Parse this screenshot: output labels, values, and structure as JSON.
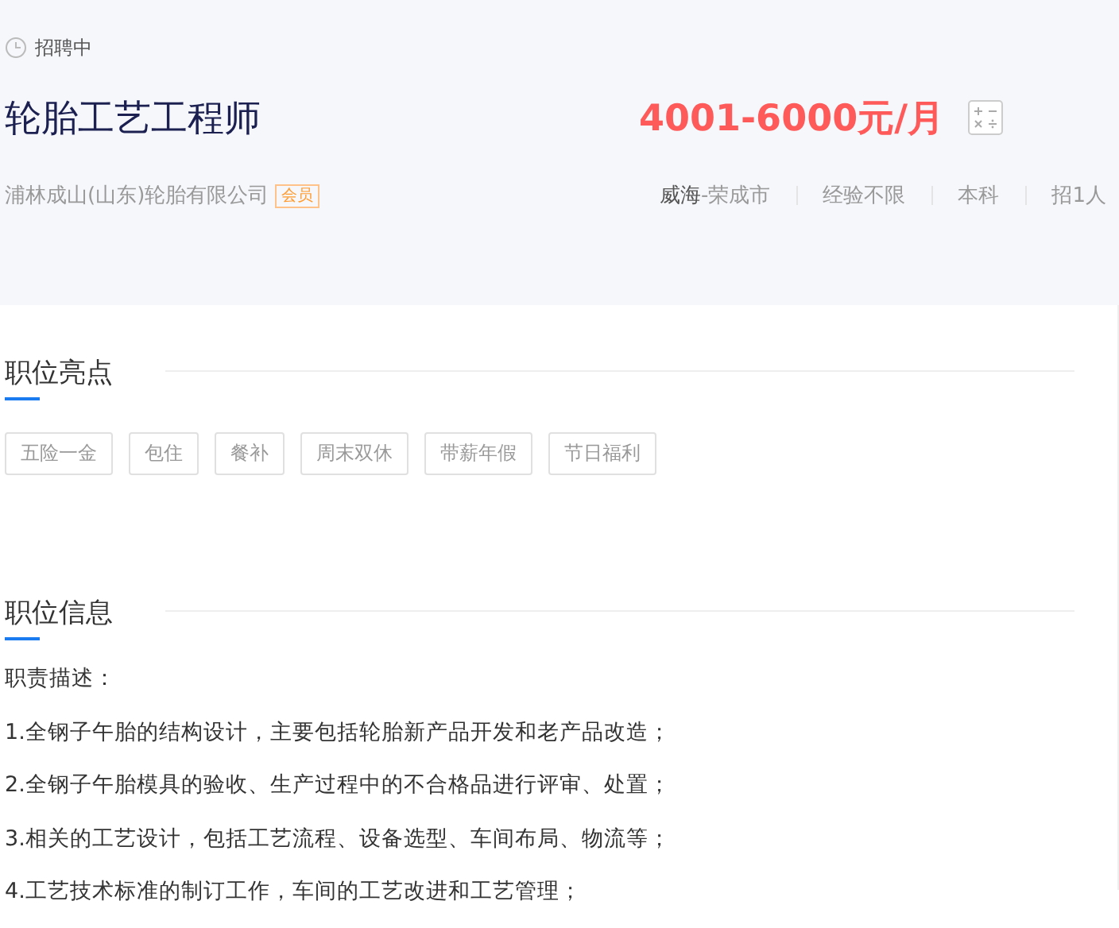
{
  "status": "招聘中",
  "title": "轮胎工艺工程师",
  "salary": "4001-6000元/月",
  "company": {
    "name": "浦林成山(山东)轮胎有限公司",
    "badge": "会员"
  },
  "meta": {
    "city": "威海",
    "district": "-荣成市",
    "items": [
      "经验不限",
      "本科",
      "招1人"
    ]
  },
  "highlights": {
    "heading": "职位亮点",
    "tags": [
      "五险一金",
      "包住",
      "餐补",
      "周末双休",
      "带薪年假",
      "节日福利"
    ]
  },
  "info": {
    "heading": "职位信息",
    "lines": [
      "职责描述：",
      "1.全钢子午胎的结构设计，主要包括轮胎新产品开发和老产品改造；",
      "2.全钢子午胎模具的验收、生产过程中的不合格品进行评审、处置；",
      "3.相关的工艺设计，包括工艺流程、设备选型、车间布局、物流等；",
      "4.工艺技术标准的制订工作，车间的工艺改进和工艺管理；"
    ]
  }
}
